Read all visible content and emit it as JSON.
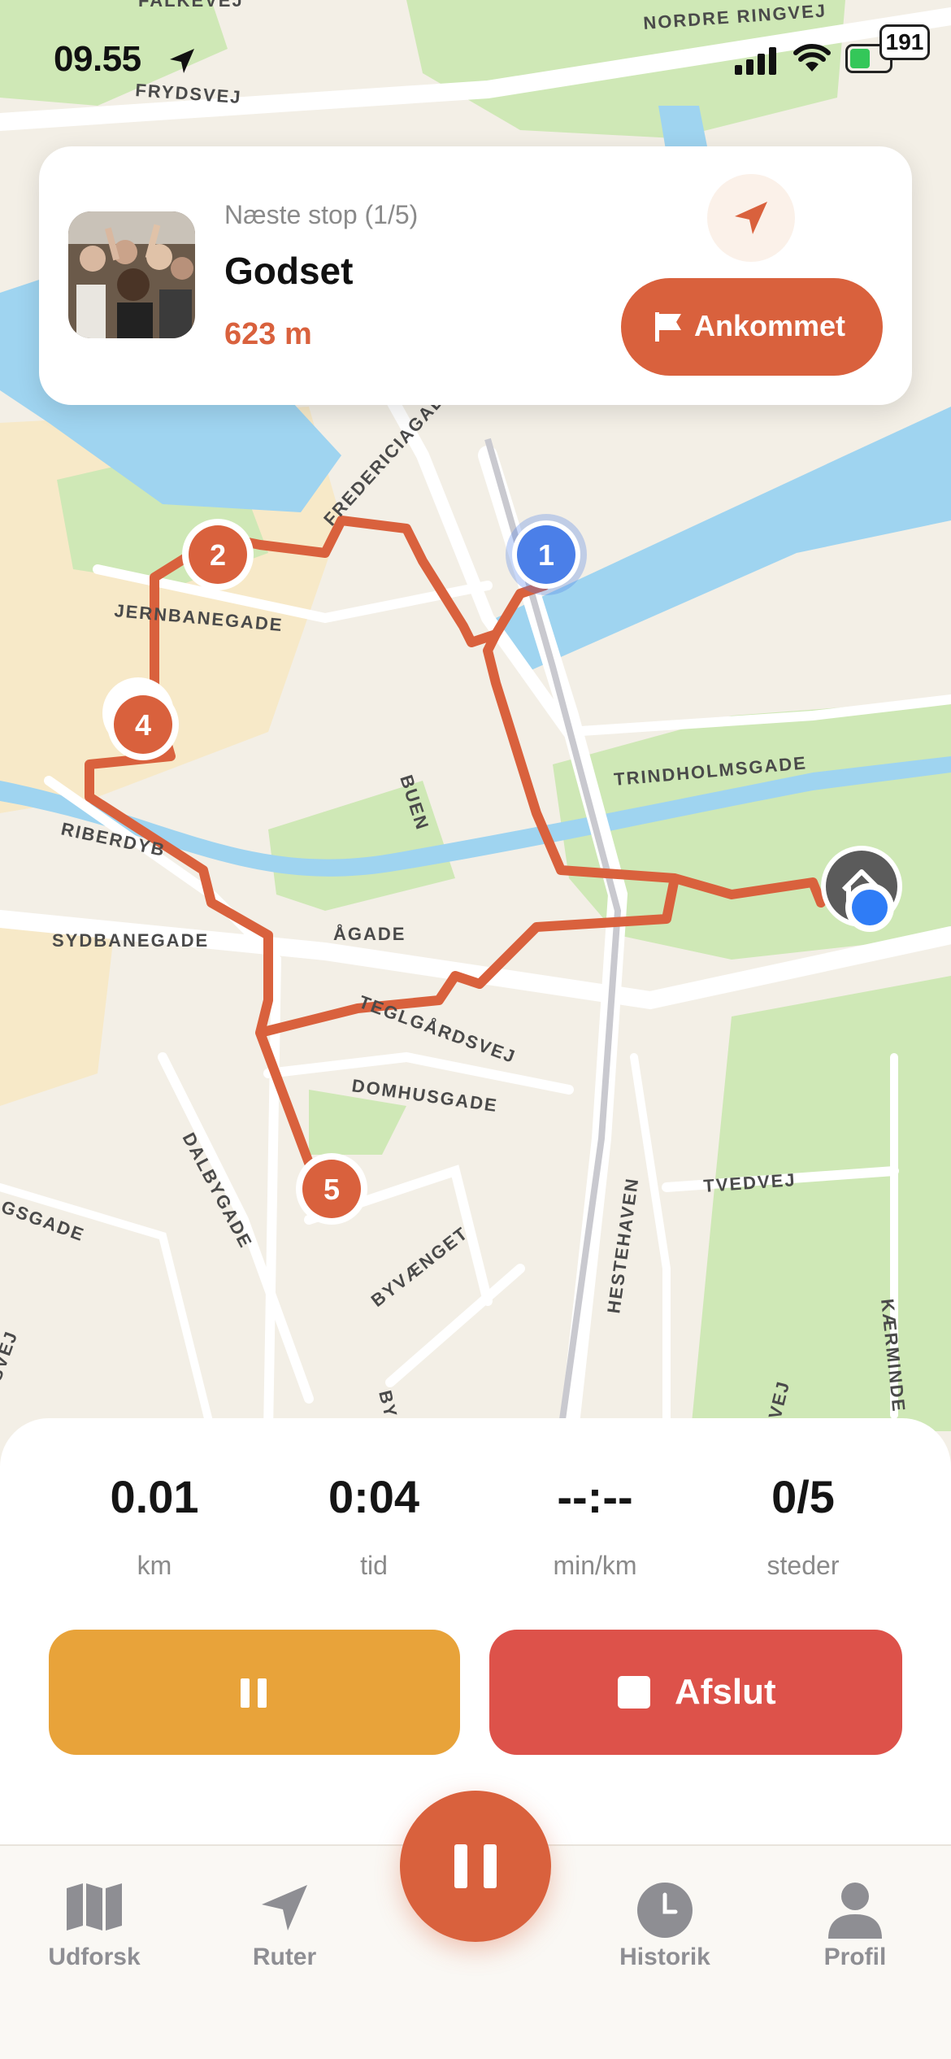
{
  "status_bar": {
    "time": "09.55",
    "battery_level": "191"
  },
  "map": {
    "street_labels": [
      "FALKEVEJ",
      "NORDRE RINGVEJ",
      "FRYDSVEJ",
      "FREDERICIAGADE",
      "JERNBANEGADE",
      "BUEN",
      "TRINDHOLMSGADE",
      "RIBERDYB",
      "SYDBANEGADE",
      "ÅGADE",
      "TEGLGÅRDSVEJ",
      "DOMHUSGADE",
      "DALBYGADE",
      "TVEDVEJ",
      "HESTEHAVEN",
      "BYVÆNGET",
      "GSGADE",
      "SVEJ",
      "KÆRMINDE",
      "BY",
      "VEJ"
    ],
    "markers": [
      "1",
      "2",
      "4",
      "5"
    ],
    "colors": {
      "route": "#d9613d",
      "water": "#9fd4f0",
      "park": "#c8e6b0",
      "current_marker": "#4b7fe8"
    }
  },
  "next_stop": {
    "label": "Næste stop (1/5)",
    "name": "Godset",
    "distance": "623 m",
    "arrived_label": "Ankommet"
  },
  "stats": [
    {
      "value": "0.01",
      "unit": "km"
    },
    {
      "value": "0:04",
      "unit": "tid"
    },
    {
      "value": "--:--",
      "unit": "min/km"
    },
    {
      "value": "0/5",
      "unit": "steder"
    }
  ],
  "actions": {
    "finish_label": "Afslut"
  },
  "tabs": [
    {
      "label": "Udforsk",
      "icon": "map-icon"
    },
    {
      "label": "Ruter",
      "icon": "navigation-arrow-icon"
    },
    {
      "label": "Historik",
      "icon": "clock-icon"
    },
    {
      "label": "Profil",
      "icon": "person-icon"
    }
  ]
}
